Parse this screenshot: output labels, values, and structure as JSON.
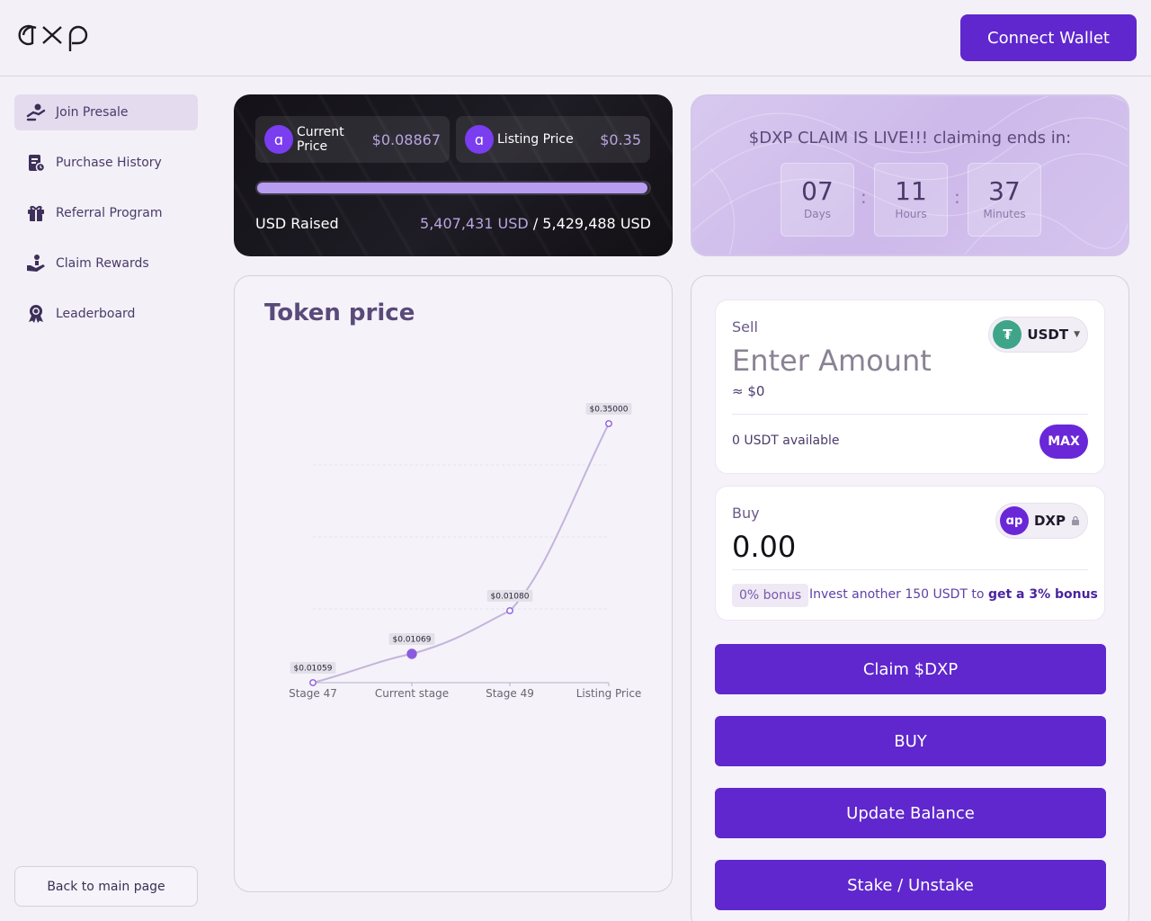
{
  "header": {
    "logo_alt": "dxp",
    "connect_label": "Connect Wallet"
  },
  "sidebar": {
    "items": [
      {
        "label": "Join Presale",
        "icon": "presale-icon",
        "active": true
      },
      {
        "label": "Purchase History",
        "icon": "history-icon"
      },
      {
        "label": "Referral Program",
        "icon": "gift-icon"
      },
      {
        "label": "Claim Rewards",
        "icon": "claim-icon"
      },
      {
        "label": "Leaderboard",
        "icon": "award-icon"
      }
    ],
    "back_label": "Back to main page"
  },
  "stats": {
    "current_price_label": "Current Price",
    "current_price_value": "$0.08867",
    "listing_price_label": "Listing Price",
    "listing_price_value": "$0.35",
    "progress_fraction": 0.996,
    "usd_raised_label": "USD Raised",
    "raised": "5,407,431 USD",
    "separator": "/",
    "goal": "5,429,488 USD"
  },
  "countdown": {
    "title": "$DXP CLAIM IS LIVE!!! claiming ends in:",
    "days": "07",
    "days_label": "Days",
    "hours": "11",
    "hours_label": "Hours",
    "minutes": "37",
    "minutes_label": "Minutes",
    "sep": ":"
  },
  "token_price": {
    "title": "Token price"
  },
  "chart_data": {
    "type": "line",
    "categories": [
      "Stage 47",
      "Current stage",
      "Stage 49",
      "Listing Price"
    ],
    "values": [
      0.01059,
      0.01069,
      0.0108,
      0.35
    ],
    "labels": [
      "$0.01059",
      "$0.01069",
      "$0.01080",
      "$0.35000"
    ],
    "highlight_index": 1
  },
  "swap": {
    "sell_label": "Sell",
    "sell_token": "USDT",
    "sell_placeholder": "Enter Amount",
    "approx_value": "≈ $0",
    "available": "0 USDT available",
    "max_label": "MAX",
    "buy_label": "Buy",
    "buy_token": "DXP",
    "buy_value": "0.00",
    "bonus_badge": "0% bonus",
    "bonus_text_prefix": "Invest another 150 USDT to",
    "bonus_text_strong": "get a 3% bonus"
  },
  "actions": {
    "claim": "Claim $DXP",
    "buy": "BUY",
    "update": "Update Balance",
    "stake": "Stake / Unstake"
  },
  "colors": {
    "accent": "#5f27cd",
    "chart_line": "#c4b4dc",
    "chart_point": "#8b5ce0"
  }
}
